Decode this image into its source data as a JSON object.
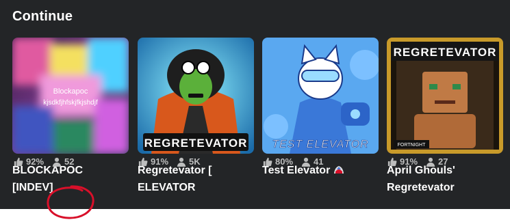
{
  "section": {
    "title": "Continue"
  },
  "games": [
    {
      "name_line1": "BLOCKAPOC",
      "name_line2": "[INDEV]",
      "thumb_text1": "Blockapoc",
      "thumb_text2": "kjsdkfjhfskjfkjshdjf",
      "rating": "92%",
      "players": "52"
    },
    {
      "name_line1": "Regretevator [",
      "name_line2": "ELEVATOR",
      "thumb_banner": "REGRETEVATOR",
      "rating": "91%",
      "players": "5K"
    },
    {
      "name_line1": "Test Elevator",
      "name_line2": "",
      "thumb_banner": "TEST ELEVATOR",
      "rating": "80%",
      "players": "41"
    },
    {
      "name_line1": "April Ghouls'",
      "name_line2": "Regretevator",
      "thumb_banner": "REGRETEVATOR",
      "thumb_tag": "FORTNIGHT",
      "rating": "91%",
      "players": "27"
    }
  ],
  "colors": {
    "background": "#232527",
    "stat_text": "#bdbebe",
    "annotation": "#d8102a"
  },
  "icons": {
    "rating": "thumbs-up-icon",
    "players": "person-icon",
    "title_decoration": "elevator-emoji-icon"
  }
}
